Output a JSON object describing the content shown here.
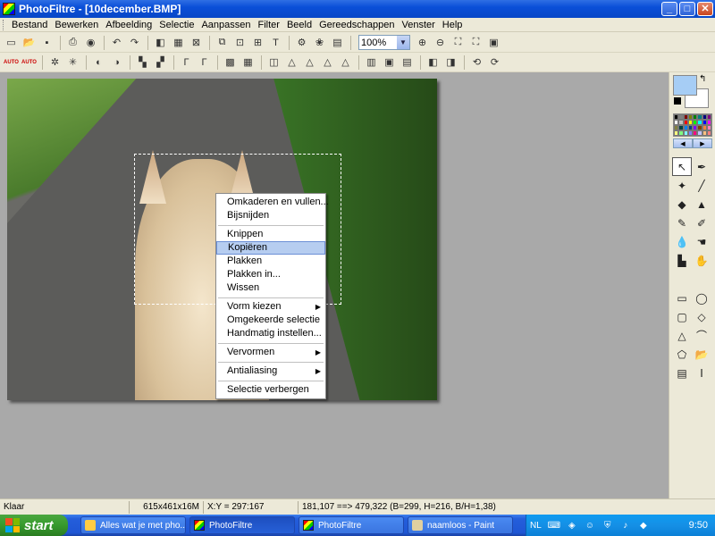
{
  "window": {
    "title": "PhotoFiltre - [10december.BMP]",
    "minimize": "_",
    "maximize": "□",
    "close": "✕"
  },
  "menu": [
    "Bestand",
    "Bewerken",
    "Afbeelding",
    "Selectie",
    "Aanpassen",
    "Filter",
    "Beeld",
    "Gereedschappen",
    "Venster",
    "Help"
  ],
  "toolbar": {
    "zoom": "100%",
    "auto_label": "AUTO",
    "text_tool": "T"
  },
  "context_menu": [
    {
      "label": "Omkaderen en vullen...",
      "highlight": false
    },
    {
      "label": "Bijsnijden",
      "highlight": false
    },
    {
      "sep": true
    },
    {
      "label": "Knippen",
      "highlight": false
    },
    {
      "label": "Kopiëren",
      "highlight": true
    },
    {
      "label": "Plakken",
      "highlight": false
    },
    {
      "label": "Plakken in...",
      "highlight": false
    },
    {
      "label": "Wissen",
      "highlight": false
    },
    {
      "sep": true
    },
    {
      "label": "Vorm kiezen",
      "submenu": true
    },
    {
      "label": "Omgekeerde selectie"
    },
    {
      "label": "Handmatig instellen..."
    },
    {
      "sep": true
    },
    {
      "label": "Vervormen",
      "submenu": true
    },
    {
      "sep": true
    },
    {
      "label": "Antialiasing",
      "submenu": true
    },
    {
      "sep": true
    },
    {
      "label": "Selectie verbergen"
    }
  ],
  "colors": {
    "foreground": "#a6cdf5",
    "background": "#ffffff"
  },
  "palette": [
    "#000000",
    "#808080",
    "#800000",
    "#808000",
    "#008000",
    "#008080",
    "#000080",
    "#800080",
    "#ffffff",
    "#c0c0c0",
    "#ff0000",
    "#ffff00",
    "#00ff00",
    "#00ffff",
    "#0000ff",
    "#ff00ff",
    "#808040",
    "#004040",
    "#0080ff",
    "#004080",
    "#8000ff",
    "#804000",
    "#ff8040",
    "#ff80c0",
    "#ffff80",
    "#80ff80",
    "#80ffff",
    "#8080ff",
    "#ff0080",
    "#c0c0ff",
    "#ffc080",
    "#ff8080"
  ],
  "status": {
    "ready": "Klaar",
    "size": "615x461x16M",
    "xy": "X:Y = 297:167",
    "selection": "181,107 ==> 479,322 (B=299, H=216, B/H=1,38)"
  },
  "taskbar": {
    "start": "start",
    "tasks": [
      "Alles wat je met pho...",
      "PhotoFiltre",
      "PhotoFiltre",
      "naamloos - Paint"
    ],
    "lang": "NL",
    "clock": "9:50"
  }
}
